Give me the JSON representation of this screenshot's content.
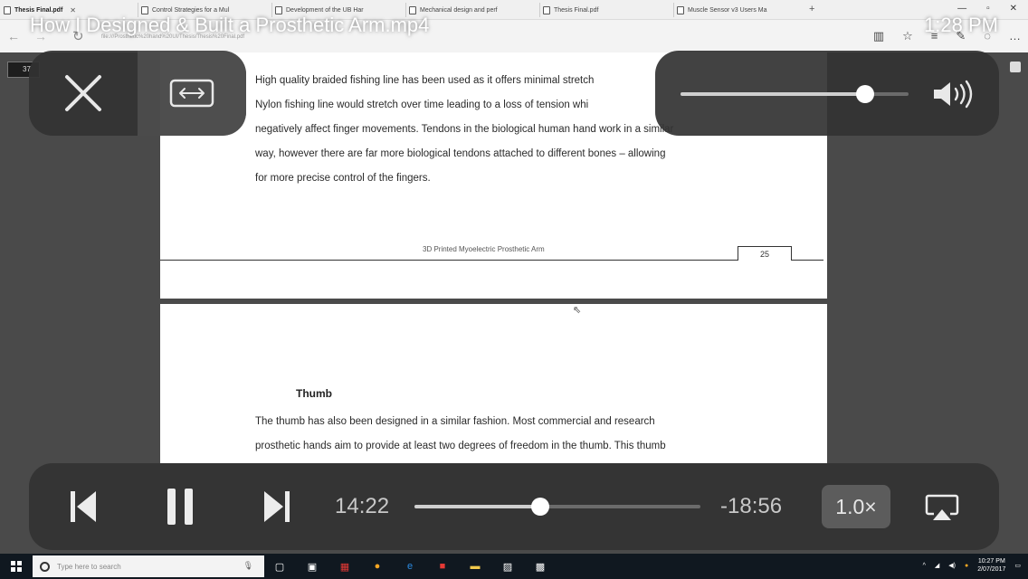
{
  "video": {
    "title": "How I Designed & Built a Prosthetic Arm.mp4",
    "status_time": "1:28 PM"
  },
  "browser": {
    "tabs": [
      {
        "label": "Thesis Final.pdf"
      },
      {
        "label": "Control Strategies for a Mul"
      },
      {
        "label": "Development of the UB Har"
      },
      {
        "label": "Mechanical design and perf"
      },
      {
        "label": "Thesis Final.pdf"
      },
      {
        "label": "Muscle Sensor v3 Users Ma"
      }
    ],
    "url": "file:///Prosthetic%20hand%20UI/Thesis/Thesis%20Final.pdf"
  },
  "pdf": {
    "page_indicator": "37",
    "page_a": {
      "lines": [
        "High quality braided fishing line has been used as it offers minimal stretch",
        "Nylon fishing line would stretch over time leading to a loss of tension whi",
        "negatively affect finger movements. Tendons in the biological human hand work in a similar",
        "way, however there are far more biological tendons attached to different bones – allowing",
        "for more precise control of the fingers."
      ],
      "footer": "3D Printed Myoelectric Prosthetic Arm",
      "page_number": "25"
    },
    "page_b": {
      "heading": "Thumb",
      "lines": [
        "The thumb has also been designed in a similar fashion. Most commercial and research",
        "prosthetic hands aim to provide at least two degrees of freedom in the thumb. This thumb"
      ]
    }
  },
  "taskbar": {
    "search_placeholder": "Type here to search",
    "clock_time": "10:27 PM",
    "clock_date": "2/07/2017"
  },
  "player": {
    "volume_level": 0.81,
    "elapsed": "14:22",
    "remaining": "-18:56",
    "progress": 0.44,
    "speed": "1.0×"
  },
  "colors": {
    "hud_background": "#323232",
    "text_light": "#c8c8c8",
    "taskbar": "#101820"
  }
}
